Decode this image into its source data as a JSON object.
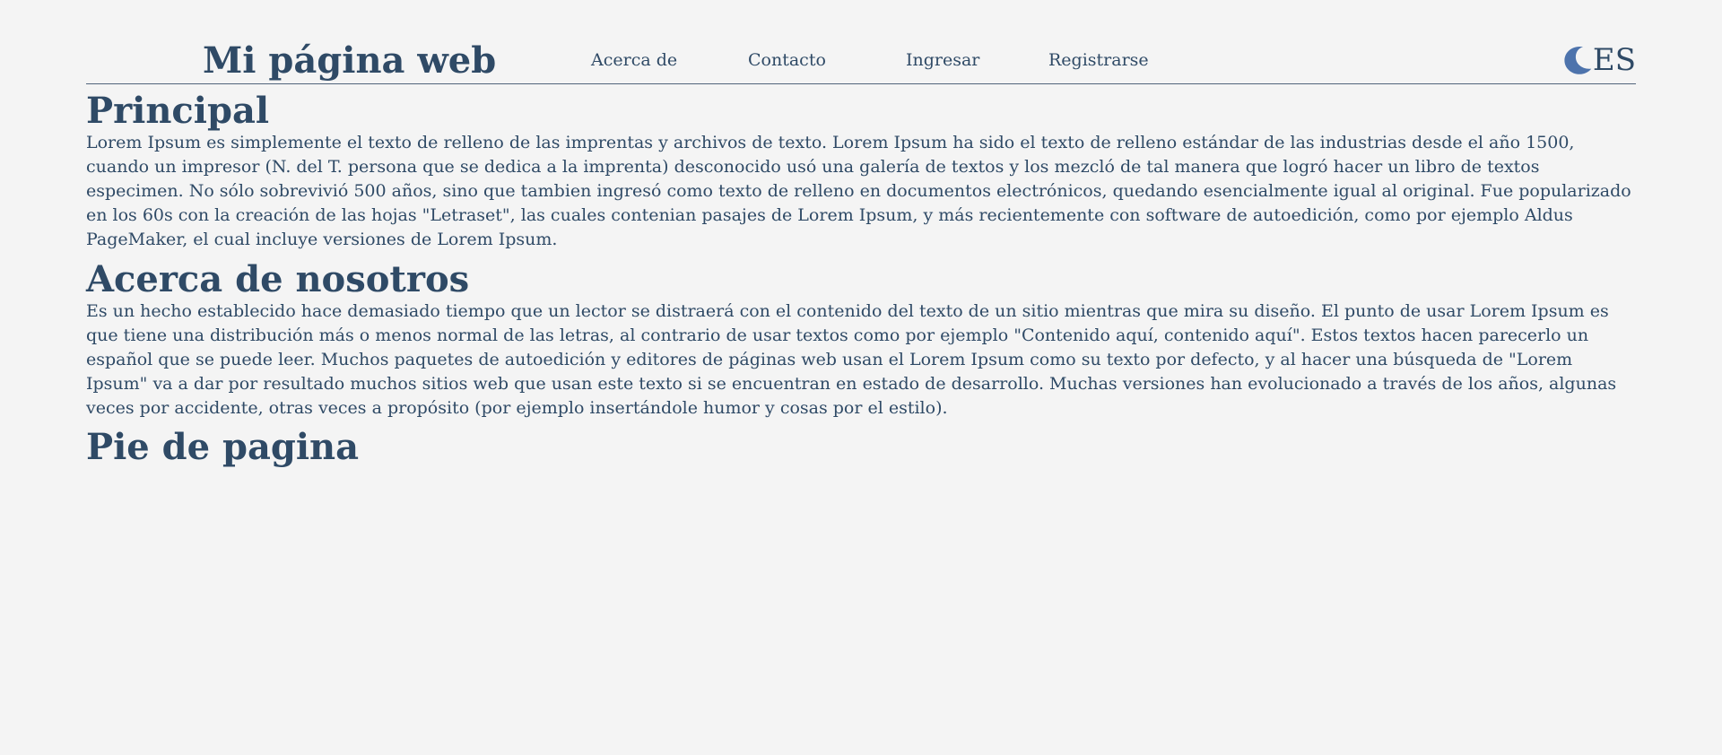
{
  "header": {
    "brand": "Mi página web",
    "nav": [
      {
        "label": "Acerca de"
      },
      {
        "label": "Contacto"
      },
      {
        "label": "Ingresar"
      },
      {
        "label": "Registrarse"
      }
    ],
    "language": "ES",
    "theme_icon": "moon-icon"
  },
  "sections": [
    {
      "title": "Principal",
      "text": "Lorem Ipsum es simplemente el texto de relleno de las imprentas y archivos de texto. Lorem Ipsum ha sido el texto de relleno estándar de las industrias desde el año 1500, cuando un impresor (N. del T. persona que se dedica a la imprenta) desconocido usó una galería de textos y los mezcló de tal manera que logró hacer un libro de textos especimen. No sólo sobrevivió 500 años, sino que tambien ingresó como texto de relleno en documentos electrónicos, quedando esencialmente igual al original. Fue popularizado en los 60s con la creación de las hojas \"Letraset\", las cuales contenian pasajes de Lorem Ipsum, y más recientemente con software de autoedición, como por ejemplo Aldus PageMaker, el cual incluye versiones de Lorem Ipsum."
    },
    {
      "title": "Acerca de nosotros",
      "text": "Es un hecho establecido hace demasiado tiempo que un lector se distraerá con el contenido del texto de un sitio mientras que mira su diseño. El punto de usar Lorem Ipsum es que tiene una distribución más o menos normal de las letras, al contrario de usar textos como por ejemplo \"Contenido aquí, contenido aquí\". Estos textos hacen parecerlo un español que se puede leer. Muchos paquetes de autoedición y editores de páginas web usan el Lorem Ipsum como su texto por defecto, y al hacer una búsqueda de \"Lorem Ipsum\" va a dar por resultado muchos sitios web que usan este texto si se encuentran en estado de desarrollo. Muchas versiones han evolucionado a través de los años, algunas veces por accidente, otras veces a propósito (por ejemplo insertándole humor y cosas por el estilo)."
    },
    {
      "title": "Pie de pagina"
    }
  ],
  "colors": {
    "background": "#f4f4f4",
    "text": "#2f4a66",
    "accent": "#4d73ac",
    "divider": "#51657c"
  }
}
